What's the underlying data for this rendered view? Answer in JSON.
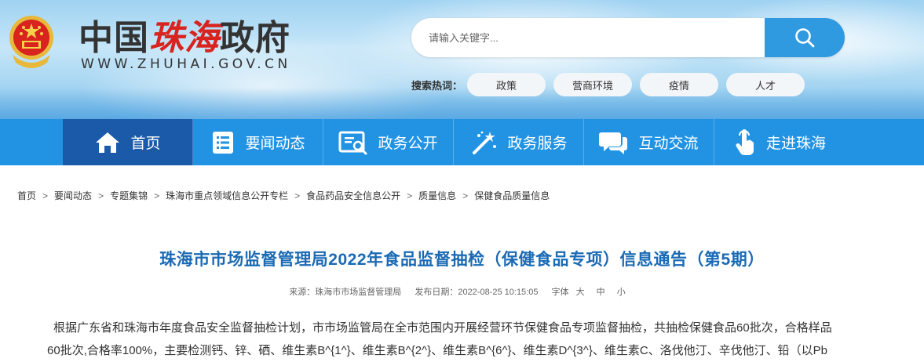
{
  "header": {
    "title_part1": "中国",
    "title_part2": "珠海",
    "title_part3": "政府",
    "url": "WWW.ZHUHAI.GOV.CN",
    "search_placeholder": "请输入关键字...",
    "hot_label": "搜索热词：",
    "hot_words": [
      "政策",
      "营商环境",
      "疫情",
      "人才"
    ]
  },
  "nav": {
    "items": [
      {
        "label": "首页",
        "icon": "home-icon"
      },
      {
        "label": "要闻动态",
        "icon": "news-list-icon"
      },
      {
        "label": "政务公开",
        "icon": "document-search-icon"
      },
      {
        "label": "政务服务",
        "icon": "magic-wand-icon"
      },
      {
        "label": "互动交流",
        "icon": "chat-bubbles-icon"
      },
      {
        "label": "走进珠海",
        "icon": "hand-pointer-icon"
      }
    ]
  },
  "breadcrumb": [
    "首页",
    "要闻动态",
    "专题集锦",
    "珠海市重点领域信息公开专栏",
    "食品药品安全信息公开",
    "质量信息",
    "保健食品质量信息"
  ],
  "article": {
    "title": "珠海市市场监督管理局2022年食品监督抽检（保健食品专项）信息通告（第5期）",
    "source": "来源：珠海市市场监督管理局",
    "date": "发布日期：2022-08-25 10:15:05",
    "font_label": "字体",
    "font_large": "大",
    "font_medium": "中",
    "font_small": "小",
    "line1": "根据广东省和珠海市年度食品安全监督抽检计划，市市场监管局在全市范围内开展经营环节保健食品专项监督抽检，共抽检保健食品60批次，合格样品",
    "line2": "60批次,合格率100%，主要检测钙、锌、硒、维生素B^{1^}、维生素B^{2^}、维生素B^{6^}、维生素D^{3^}、维生素C、洛伐他汀、辛伐他汀、铅（以Pb"
  },
  "colors": {
    "nav_bg": "#2293e3",
    "nav_active": "#1a5aa8",
    "title_blue": "#1a6ab5",
    "brand_red": "#d8231e"
  }
}
